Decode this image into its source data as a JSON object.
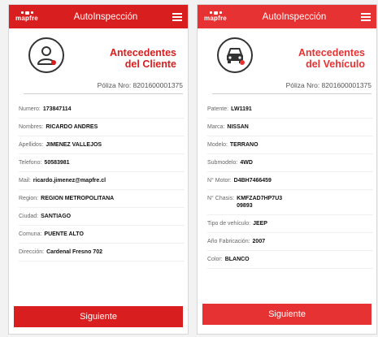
{
  "colors": {
    "brand_red": "#d81e1e",
    "accent": "#e63232"
  },
  "app": {
    "logo_text": "mapfre",
    "title": "AutoInspección"
  },
  "client_screen": {
    "title_line1": "Antecedentes",
    "title_line2": "del Cliente",
    "icon": "user-icon",
    "poliza": "Póliza Nro: 8201600001375",
    "fields": [
      {
        "label": "Numero:",
        "value": "173847114"
      },
      {
        "label": "Nombres:",
        "value": "RICARDO ANDRES"
      },
      {
        "label": "Apellidos:",
        "value": "JIMENEZ VALLEJOS"
      },
      {
        "label": "Telefono:",
        "value": "50583981"
      },
      {
        "label": "Mail:",
        "value": "ricardo.jimenez@mapfre.cl"
      },
      {
        "label": "Region:",
        "value": "REGION METROPOLITANA"
      },
      {
        "label": "Ciudad:",
        "value": "SANTIAGO"
      },
      {
        "label": "Comuna:",
        "value": "PUENTE ALTO"
      },
      {
        "label": "Dirección:",
        "value": "Cardenal Fresno 702"
      }
    ],
    "button_label": "Siguiente"
  },
  "vehicle_screen": {
    "title_line1": "Antecedentes",
    "title_line2": "del Vehículo",
    "icon": "car-icon",
    "poliza": "Póliza Nro: 8201600001375",
    "fields": [
      {
        "label": "Patente:",
        "value": "LW1191"
      },
      {
        "label": "Marca:",
        "value": "NISSAN"
      },
      {
        "label": "Modelo:",
        "value": "TERRANO"
      },
      {
        "label": "Submodelo:",
        "value": "4WD"
      },
      {
        "label": "N° Motor:",
        "value": "D4BH7466459"
      },
      {
        "label": "N° Chasis:",
        "value": "KMFZAD7HP7U309893"
      },
      {
        "label": "Tipo de vehículo:",
        "value": "JEEP"
      },
      {
        "label": "Año Fabricación:",
        "value": "2007"
      },
      {
        "label": "Color:",
        "value": "BLANCO"
      }
    ],
    "button_label": "Siguiente"
  }
}
